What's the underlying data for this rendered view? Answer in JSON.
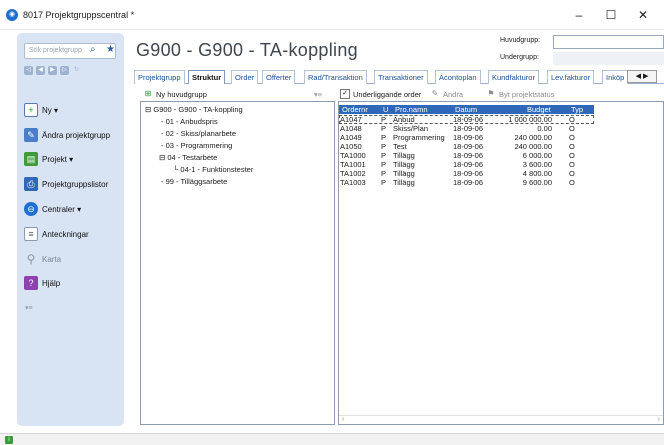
{
  "window": {
    "title": "8017 Projektgruppscentral *",
    "minimize": "–",
    "maximize": "☐",
    "close": "✕"
  },
  "sidebar": {
    "search_placeholder": "Sök projektgrupp",
    "nav": [
      "◁",
      "◀",
      "▶",
      "▷",
      "↻"
    ],
    "items": [
      {
        "label": "Ny ▾",
        "icon": "new-document-icon"
      },
      {
        "label": "Ändra projektgrupp",
        "icon": "edit-icon"
      },
      {
        "label": "Projekt ▾",
        "icon": "project-icon"
      },
      {
        "label": "Projektgruppslistor",
        "icon": "printer-icon"
      },
      {
        "label": "Centraler ▾",
        "icon": "central-icon"
      },
      {
        "label": "Anteckningar",
        "icon": "notes-icon"
      },
      {
        "label": "Karta",
        "icon": "map-pin-icon"
      },
      {
        "label": "Hjälp",
        "icon": "help-icon"
      }
    ]
  },
  "header": {
    "title": "G900 - G900 - TA-koppling",
    "huvudgrupp_label": "Huvudgrupp:",
    "undergrupp_label": "Undergrupp:"
  },
  "tabs": [
    "Projektgrupp",
    "Struktur",
    "Order",
    "Offerter",
    "Rad/Transaktion",
    "Transaktioner",
    "Acontoplan",
    "Kundfakturor",
    "Lev.fakturor",
    "Inköp"
  ],
  "toolbar": {
    "ny_huvudgrupp": "Ny huvudgrupp",
    "underliggande": "Underliggande order",
    "andra": "Ändra",
    "byt_status": "Byt projektstatus"
  },
  "tree": {
    "root": "G900 - G900 - TA-koppling",
    "items": [
      "01 - Anbudspris",
      "02 - Skiss/planarbete",
      "03 - Programmering",
      "04 - Testarbete",
      "04-1 - Funktionstester",
      "99 - Tilläggsarbete"
    ]
  },
  "grid": {
    "headers": [
      "Ordernr",
      "U",
      "Pro.namn",
      "Datum",
      "Budget",
      "Typ"
    ],
    "rows": [
      [
        "A1047",
        "P",
        "Anbud",
        "18-09-06",
        "1 000 000.00",
        "O"
      ],
      [
        "A1048",
        "P",
        "Skiss/Plan",
        "18-09-06",
        "0.00",
        "O"
      ],
      [
        "A1049",
        "P",
        "Programmering",
        "18-09-06",
        "240 000.00",
        "O"
      ],
      [
        "A1050",
        "P",
        "Test",
        "18-09-06",
        "240 000.00",
        "O"
      ],
      [
        "TA1000",
        "P",
        "Tillägg",
        "18-09-06",
        "6 000.00",
        "O"
      ],
      [
        "TA1001",
        "P",
        "Tillägg",
        "18-09-06",
        "3 600.00",
        "O"
      ],
      [
        "TA1002",
        "P",
        "Tillägg",
        "18-09-06",
        "4 800.00",
        "O"
      ],
      [
        "TA1003",
        "P",
        "Tillägg",
        "18-09-06",
        "9 600.00",
        "O"
      ]
    ]
  }
}
